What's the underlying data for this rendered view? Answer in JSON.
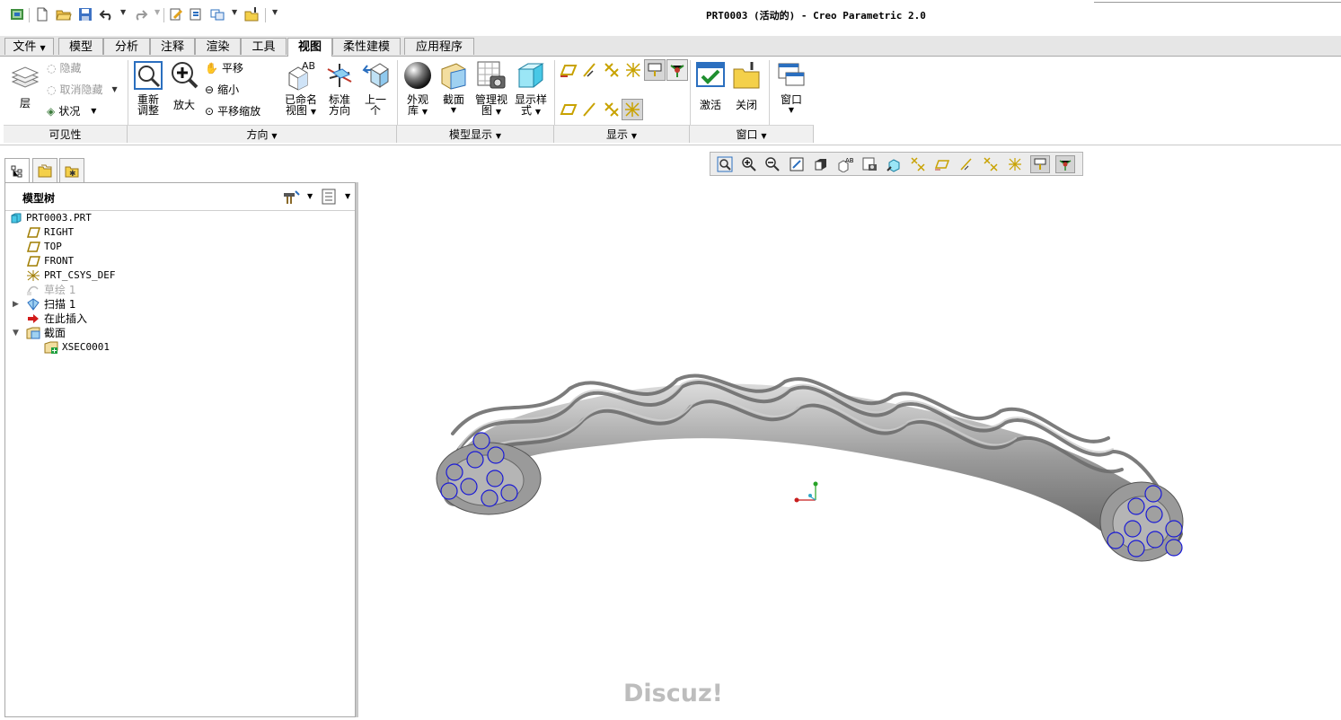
{
  "window": {
    "title": "PRT0003 (活动的) - Creo Parametric 2.0"
  },
  "quick_access": {
    "icons": [
      "app-icon",
      "new-icon",
      "open-icon",
      "save-icon",
      "undo-icon",
      "redo-icon",
      "regenerate-icon",
      "switch-window-icon",
      "window-icon",
      "close-window-icon"
    ]
  },
  "ribbon": {
    "tabs": [
      {
        "label": "文件",
        "has_dropdown": true
      },
      {
        "label": "模型"
      },
      {
        "label": "分析"
      },
      {
        "label": "注释"
      },
      {
        "label": "渲染"
      },
      {
        "label": "工具"
      },
      {
        "label": "视图",
        "active": true
      },
      {
        "label": "柔性建模"
      },
      {
        "label": "应用程序"
      }
    ],
    "visibility": {
      "footer": "可见性",
      "layer": "层",
      "hide": "隐藏",
      "unhide": "取消隐藏",
      "status": "状况"
    },
    "orientation": {
      "footer": "方向",
      "refit": "重新调整",
      "refit_l1": "重新",
      "refit_l2": "调整",
      "zoom_in": "放大",
      "pan": "平移",
      "zoom_out": "缩小",
      "pan_zoom": "平移缩放",
      "saved_views_l1": "已命名",
      "saved_views_l2": "视图",
      "standard_l1": "标准",
      "standard_l2": "方向",
      "previous_l1": "上一",
      "previous_l2": "个"
    },
    "model_display": {
      "footer": "模型显示",
      "appearance_l1": "外观",
      "appearance_l2": "库",
      "section": "截面",
      "manage_l1": "管理视",
      "manage_l2": "图",
      "display_style_l1": "显示样",
      "display_style_l2": "式"
    },
    "show": {
      "footer": "显示"
    },
    "window": {
      "footer": "窗口",
      "activate": "激活",
      "close": "关闭",
      "windows": "窗口"
    }
  },
  "model_tree": {
    "title": "模型树",
    "items": [
      {
        "label": "PRT0003.PRT",
        "icon": "part-icon"
      },
      {
        "label": "RIGHT",
        "icon": "datum-plane-icon"
      },
      {
        "label": "TOP",
        "icon": "datum-plane-icon"
      },
      {
        "label": "FRONT",
        "icon": "datum-plane-icon"
      },
      {
        "label": "PRT_CSYS_DEF",
        "icon": "csys-icon"
      },
      {
        "label": "草绘 1",
        "icon": "sketch-icon",
        "suppressed": true
      },
      {
        "label": "扫描 1",
        "icon": "sweep-icon",
        "collapsed": true
      },
      {
        "label": "在此插入",
        "icon": "insert-here-arrow-icon"
      },
      {
        "label": "截面",
        "icon": "section-folder-icon",
        "expanded": true
      },
      {
        "label": "XSEC0001",
        "icon": "xsec-icon"
      }
    ]
  },
  "viewport": {
    "watermark": "Discuz!"
  },
  "colors": {
    "tab_bg": "#e6e6e6",
    "accent_blue": "#1b5fbf",
    "datum_yellow": "#c8a200",
    "model_gray": "#8a8a8a",
    "section_circle": "#1a1ad6"
  }
}
